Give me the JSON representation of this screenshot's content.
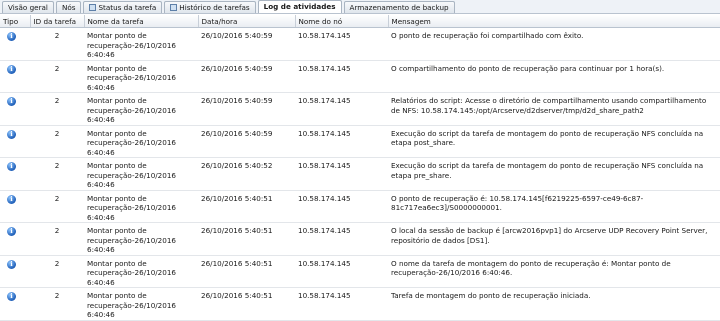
{
  "tabs": [
    {
      "label": "Visão geral",
      "active": false,
      "icon": null
    },
    {
      "label": "Nós",
      "active": false,
      "icon": null
    },
    {
      "label": "Status da tarefa",
      "active": false,
      "icon": "window-icon"
    },
    {
      "label": "Histórico de tarefas",
      "active": false,
      "icon": "window-icon"
    },
    {
      "label": "Log de atividades",
      "active": true,
      "icon": null
    },
    {
      "label": "Armazenamento de backup",
      "active": false,
      "icon": null
    }
  ],
  "columns": {
    "type": "Tipo",
    "task_id": "ID da tarefa",
    "task_name": "Nome da tarefa",
    "datetime": "Data/hora",
    "node": "Nome do nó",
    "message": "Mensagem"
  },
  "rows": [
    {
      "type_icon": "info-icon",
      "id": "2",
      "task": "Montar ponto de recuperação-26/10/2016 6:40:46",
      "datetime": "26/10/2016 5:40:59",
      "node": "10.58.174.145",
      "message": "O ponto de recuperação foi compartilhado com êxito."
    },
    {
      "type_icon": "info-icon",
      "id": "2",
      "task": "Montar ponto de recuperação-26/10/2016 6:40:46",
      "datetime": "26/10/2016 5:40:59",
      "node": "10.58.174.145",
      "message": "O compartilhamento do ponto de recuperação para continuar por 1 hora(s)."
    },
    {
      "type_icon": "info-icon",
      "id": "2",
      "task": "Montar ponto de recuperação-26/10/2016 6:40:46",
      "datetime": "26/10/2016 5:40:59",
      "node": "10.58.174.145",
      "message": "Relatórios do script: Acesse o diretório de compartilhamento usando compartilhamento de NFS: 10.58.174.145:/opt/Arcserve/d2dserver/tmp/d2d_share_path2"
    },
    {
      "type_icon": "info-icon",
      "id": "2",
      "task": "Montar ponto de recuperação-26/10/2016 6:40:46",
      "datetime": "26/10/2016 5:40:59",
      "node": "10.58.174.145",
      "message": "Execução do script da tarefa de montagem do ponto de recuperação NFS concluída na etapa post_share."
    },
    {
      "type_icon": "info-icon",
      "id": "2",
      "task": "Montar ponto de recuperação-26/10/2016 6:40:46",
      "datetime": "26/10/2016 5:40:52",
      "node": "10.58.174.145",
      "message": "Execução do script da tarefa de montagem do ponto de recuperação NFS concluída na etapa pre_share."
    },
    {
      "type_icon": "info-icon",
      "id": "2",
      "task": "Montar ponto de recuperação-26/10/2016 6:40:46",
      "datetime": "26/10/2016 5:40:51",
      "node": "10.58.174.145",
      "message": "O ponto de recuperação é: 10.58.174.145[f6219225-6597-ce49-6c87-81c717ea6ec3]/S0000000001."
    },
    {
      "type_icon": "info-icon",
      "id": "2",
      "task": "Montar ponto de recuperação-26/10/2016 6:40:46",
      "datetime": "26/10/2016 5:40:51",
      "node": "10.58.174.145",
      "message": "O local da sessão de backup é [arcw2016pvp1] do Arcserve UDP Recovery Point Server, repositório de dados [DS1]."
    },
    {
      "type_icon": "info-icon",
      "id": "2",
      "task": "Montar ponto de recuperação-26/10/2016 6:40:46",
      "datetime": "26/10/2016 5:40:51",
      "node": "10.58.174.145",
      "message": "O nome da tarefa de montagem do ponto de recuperação é: Montar ponto de recuperação-26/10/2016 6:40:46."
    },
    {
      "type_icon": "info-icon",
      "id": "2",
      "task": "Montar ponto de recuperação-26/10/2016 6:40:46",
      "datetime": "26/10/2016 5:40:51",
      "node": "10.58.174.145",
      "message": "Tarefa de montagem do ponto de recuperação iniciada."
    }
  ]
}
